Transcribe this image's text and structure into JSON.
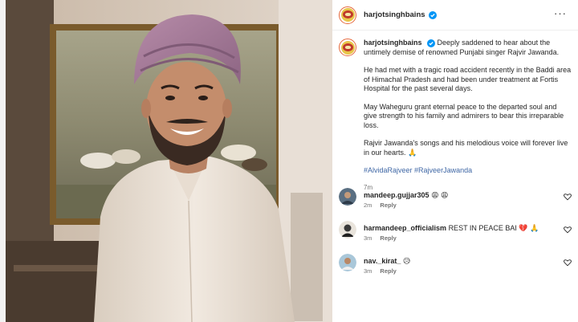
{
  "post": {
    "username": "harjotsinghbains",
    "caption": {
      "username": "harjotsinghbains",
      "paragraphs": [
        "Deeply saddened to hear about the untimely demise of renowned Punjabi singer Rajvir Jawanda.",
        "He had met with a tragic road accident recently in the Baddi area of Himachal Pradesh and had been under treatment at Fortis Hospital for the past several days.",
        "May Waheguru grant eternal peace to the departed soul and give strength to his family and admirers to bear this irreparable loss.",
        "Rajvir Jawanda's songs and his melodious voice will forever live in our hearts."
      ],
      "prayer_emoji": "🙏",
      "hashtags": [
        "#AlvidaRajveer",
        "#RajveerJawanda"
      ],
      "time": "7m"
    },
    "comments": [
      {
        "username": "mandeep.gujjar305",
        "text": "😩 😩",
        "time": "2m",
        "reply_label": "Reply"
      },
      {
        "username": "harmandeep_officialism",
        "text": "REST IN PEACE BAI 💔 🙏",
        "time": "3m",
        "reply_label": "Reply"
      },
      {
        "username": "nav._kirat_",
        "text": "😥",
        "time": "3m",
        "reply_label": "Reply"
      }
    ]
  },
  "icons": {
    "verified": "verified-badge-icon",
    "more": "more-options-icon",
    "like": "heart-icon"
  },
  "colors": {
    "verified_blue": "#0095f6",
    "hashtag": "#3f67a5",
    "meta_gray": "#737373",
    "turban": "#a87a9a",
    "shirt": "#ece2d8"
  }
}
